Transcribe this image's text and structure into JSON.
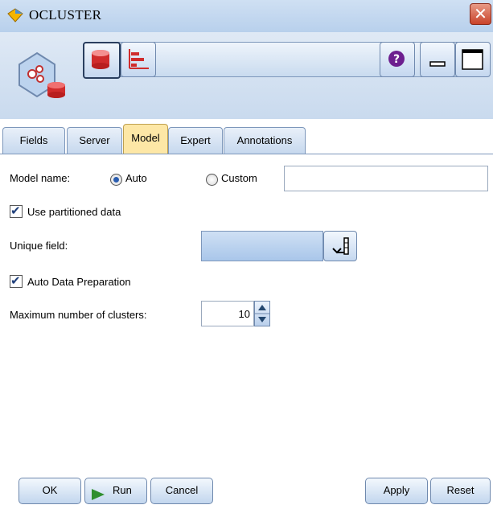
{
  "window": {
    "title": "OCLUSTER",
    "close_glyph": "✕"
  },
  "toolbar": {
    "buttons": [
      {
        "icon": "database-icon"
      },
      {
        "icon": "bar-chart-icon"
      }
    ],
    "help_glyph": "?",
    "help_icon": "help-icon",
    "minimize_icon": "minimize-icon",
    "maximize_icon": "maximize-icon"
  },
  "tabs": [
    {
      "label": "Fields",
      "active": false
    },
    {
      "label": "Server",
      "active": false
    },
    {
      "label": "Model",
      "active": true
    },
    {
      "label": "Expert",
      "active": false
    },
    {
      "label": "Annotations",
      "active": false
    }
  ],
  "model_tab": {
    "model_name_label": "Model name:",
    "radio_auto_label": "Auto",
    "radio_custom_label": "Custom",
    "model_name_selected": "Auto",
    "custom_value": "",
    "use_partitioned_label": "Use partitioned data",
    "use_partitioned_checked": true,
    "unique_field_label": "Unique field:",
    "unique_field_value": "",
    "auto_data_prep_label": "Auto Data Preparation",
    "auto_data_prep_checked": true,
    "max_clusters_label": "Maximum number of clusters:",
    "max_clusters_value": "10"
  },
  "buttons": {
    "ok": "OK",
    "run": "Run",
    "cancel": "Cancel",
    "apply": "Apply",
    "reset": "Reset"
  },
  "colors": {
    "title_bar": "#c4d8ef",
    "active_tab": "#fde7a6",
    "close_button": "#c9432a",
    "run_icon": "#2f8f2f"
  }
}
